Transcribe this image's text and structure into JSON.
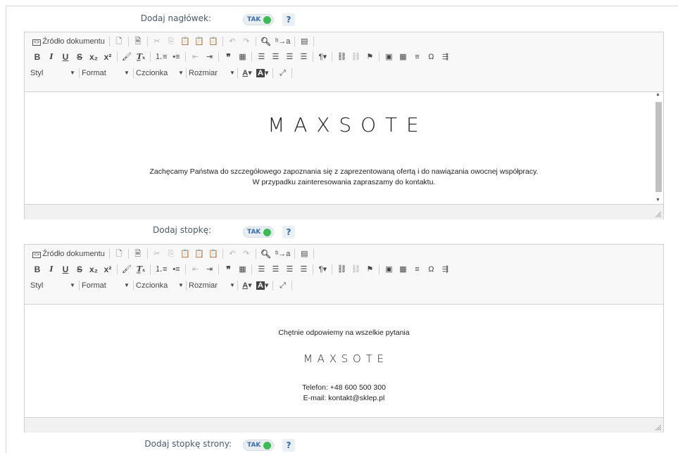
{
  "header_section": {
    "label": "Dodaj nagłówek:",
    "toggle_text": "TAK",
    "help": "?"
  },
  "footer_section": {
    "label": "Dodaj stopkę:",
    "toggle_text": "TAK",
    "help": "?"
  },
  "page_footer_section": {
    "label": "Dodaj stopkę strony:",
    "toggle_text": "TAK",
    "help": "?"
  },
  "toolbar": {
    "source_label": "Źródło dokumentu",
    "styles_label": "Styl",
    "format_label": "Format",
    "font_label": "Czcionka",
    "size_label": "Rozmiar"
  },
  "header_editor": {
    "brand": "M A X S O T E",
    "line1": "Zachęcamy Państwa do szczegółowego zapoznania się z zaprezentowaną ofertą i do nawiązania owocnej współpracy.",
    "line2": "W przypadku zainteresowania zapraszamy do kontaktu."
  },
  "footer_editor": {
    "intro": "Chętnie odpowiemy na wszelkie pytania",
    "brand": "M A X S O T E",
    "phone": "Telefon: +48 600 500 300",
    "email": "E-mail: kontakt@sklep.pl"
  },
  "colors": {
    "toggle_on": "#3cba54",
    "label_text": "#4a5a6a",
    "help_text": "#2f66a8"
  }
}
